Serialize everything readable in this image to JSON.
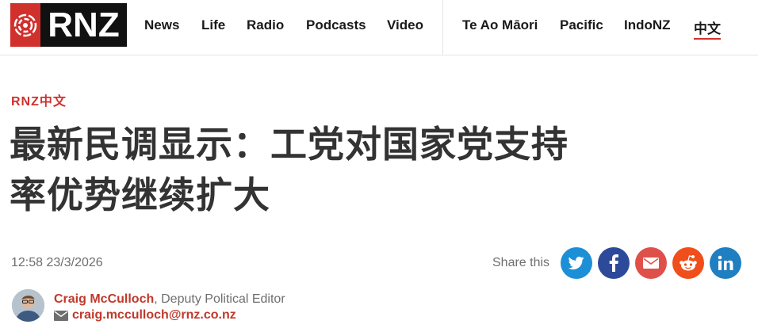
{
  "logo": {
    "text": "RNZ"
  },
  "nav": {
    "primary": [
      {
        "label": "News"
      },
      {
        "label": "Life"
      },
      {
        "label": "Radio"
      },
      {
        "label": "Podcasts"
      },
      {
        "label": "Video"
      }
    ],
    "secondary": [
      {
        "label": "Te Ao Māori"
      },
      {
        "label": "Pacific"
      },
      {
        "label": "IndoNZ"
      },
      {
        "label": "中文",
        "active": true
      }
    ]
  },
  "article": {
    "section": "RNZ中文",
    "headline_line1": "最新民调显示：工党对国家党支持",
    "headline_line2": "率优势继续扩大",
    "timestamp": "12:58 23/3/2026",
    "share_label": "Share this",
    "share_buttons": [
      {
        "icon": "twitter-icon",
        "color": "#1d8fd6"
      },
      {
        "icon": "facebook-icon",
        "color": "#2d4a9a"
      },
      {
        "icon": "email-icon",
        "color": "#e0504a"
      },
      {
        "icon": "reddit-icon",
        "color": "#f04e1a"
      },
      {
        "icon": "linkedin-icon",
        "color": "#1f7fc0"
      }
    ]
  },
  "byline": {
    "author": "Craig McCulloch",
    "role": ", Deputy Political Editor",
    "email": "craig.mcculloch@rnz.co.nz"
  },
  "colors": {
    "brand_red": "#d0312d",
    "link_red": "#c0392b",
    "text_dark": "#333333",
    "muted": "#6e6e6e"
  }
}
